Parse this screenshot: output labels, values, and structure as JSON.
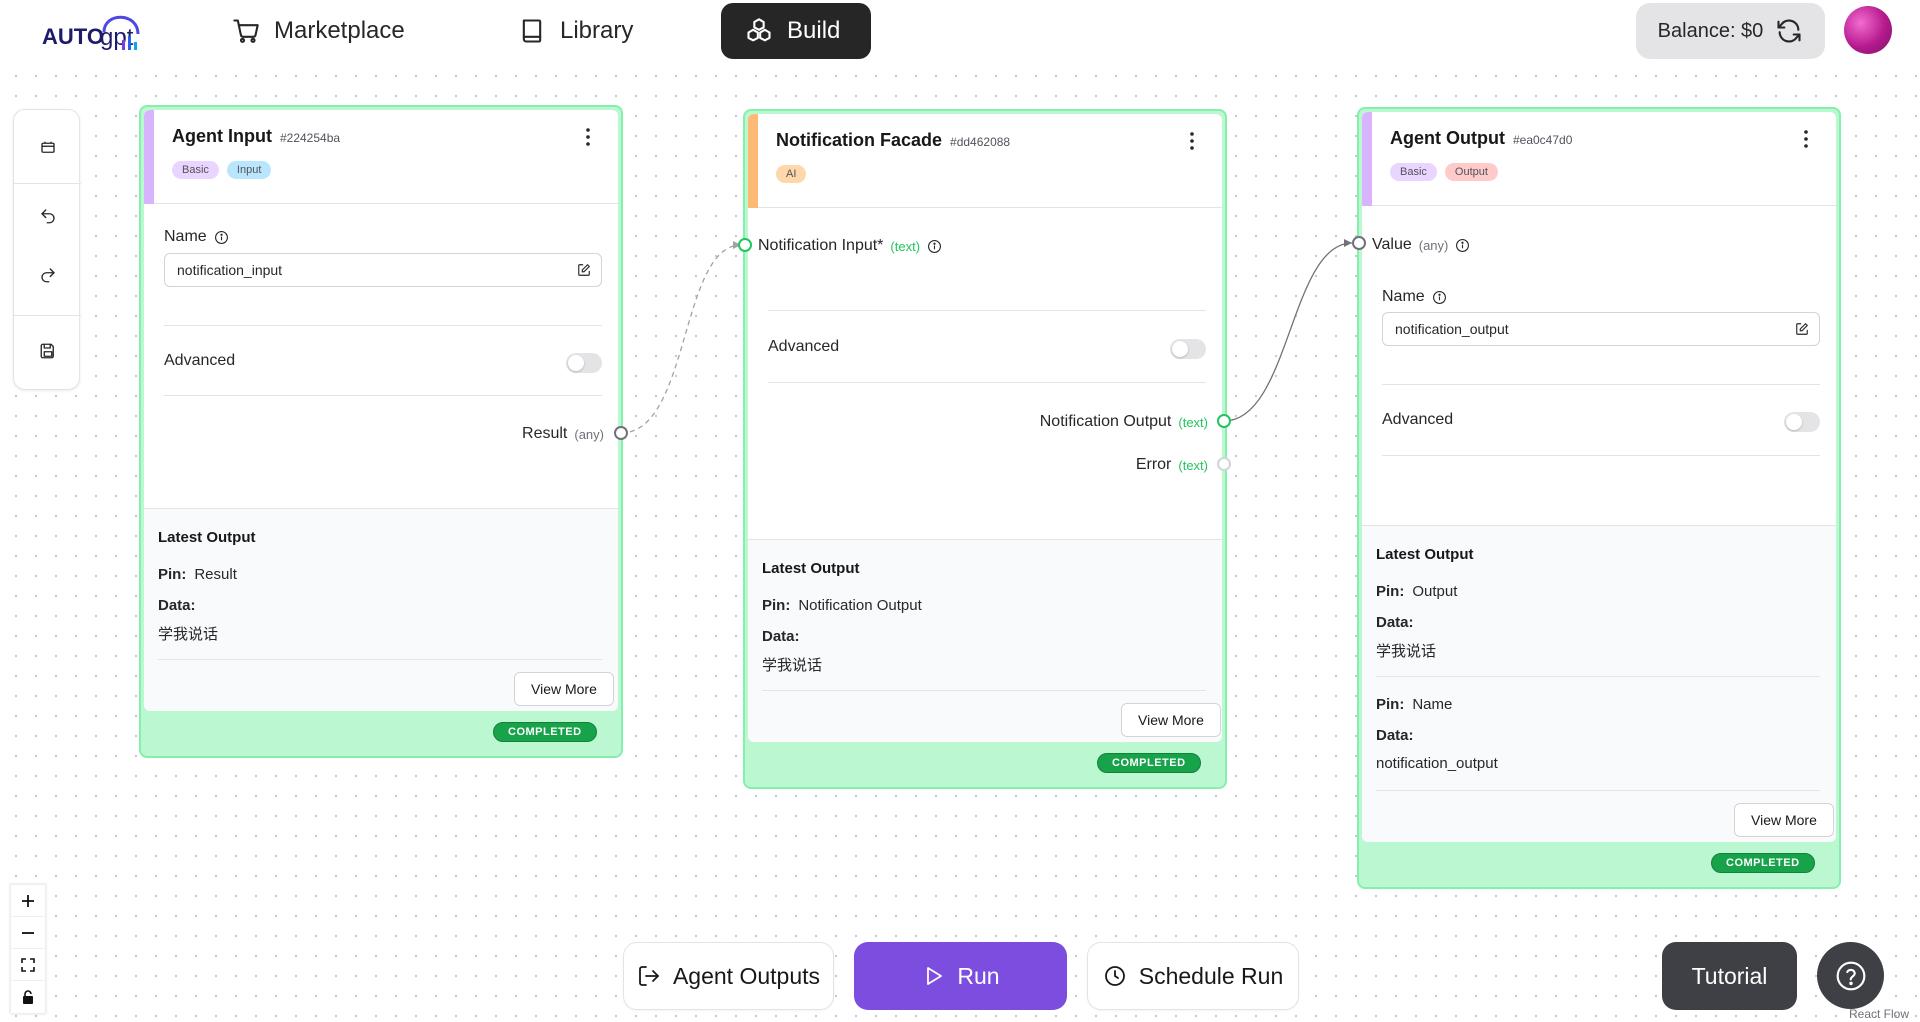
{
  "header": {
    "logo_text": "AUTOgpt",
    "nav": [
      {
        "label": "Marketplace",
        "icon": "cart-icon"
      },
      {
        "label": "Library",
        "icon": "book-icon"
      },
      {
        "label": "Build",
        "icon": "blocks-icon",
        "active": true
      }
    ],
    "balance": "Balance: $0"
  },
  "colors": {
    "node_border": "#86efac",
    "node_bg": "#bbf7d0",
    "run_button": "#7c4ddf",
    "completed": "#16a34a",
    "stripe_input": "#d8b4fe",
    "stripe_ai": "#fdba74"
  },
  "nodes": {
    "agent_input": {
      "title": "Agent Input",
      "id": "#224254ba",
      "badges": [
        "Basic",
        "Input"
      ],
      "name_label": "Name",
      "name_value": "notification_input",
      "advanced_label": "Advanced",
      "advanced_on": false,
      "output_pin_label": "Result",
      "output_pin_type": "(any)",
      "latest_output_title": "Latest Output",
      "pin_label": "Pin:",
      "pin_value": "Result",
      "data_label": "Data:",
      "data_value": "学我说话",
      "view_more": "View More",
      "status": "COMPLETED"
    },
    "notification_facade": {
      "title": "Notification Facade",
      "id": "#dd462088",
      "badges": [
        "AI"
      ],
      "input_pin_label": "Notification Input*",
      "input_pin_type": "(text)",
      "advanced_label": "Advanced",
      "advanced_on": false,
      "output_pin_label": "Notification Output",
      "output_pin_type": "(text)",
      "error_pin_label": "Error",
      "error_pin_type": "(text)",
      "latest_output_title": "Latest Output",
      "pin_label": "Pin:",
      "pin_value": "Notification Output",
      "data_label": "Data:",
      "data_value": "学我说话",
      "view_more": "View More",
      "status": "COMPLETED"
    },
    "agent_output": {
      "title": "Agent Output",
      "id": "#ea0c47d0",
      "badges": [
        "Basic",
        "Output"
      ],
      "value_pin_label": "Value",
      "value_pin_type": "(any)",
      "name_label": "Name",
      "name_value": "notification_output",
      "advanced_label": "Advanced",
      "advanced_on": false,
      "latest_output_title": "Latest Output",
      "outputs": [
        {
          "pin_label": "Pin:",
          "pin_value": "Output",
          "data_label": "Data:",
          "data_value": "学我说话"
        },
        {
          "pin_label": "Pin:",
          "pin_value": "Name",
          "data_label": "Data:",
          "data_value": "notification_output"
        }
      ],
      "view_more": "View More",
      "status": "COMPLETED"
    }
  },
  "bottom_bar": {
    "agent_outputs": "Agent Outputs",
    "run": "Run",
    "schedule_run": "Schedule Run",
    "tutorial": "Tutorial"
  },
  "attribution": "React Flow"
}
